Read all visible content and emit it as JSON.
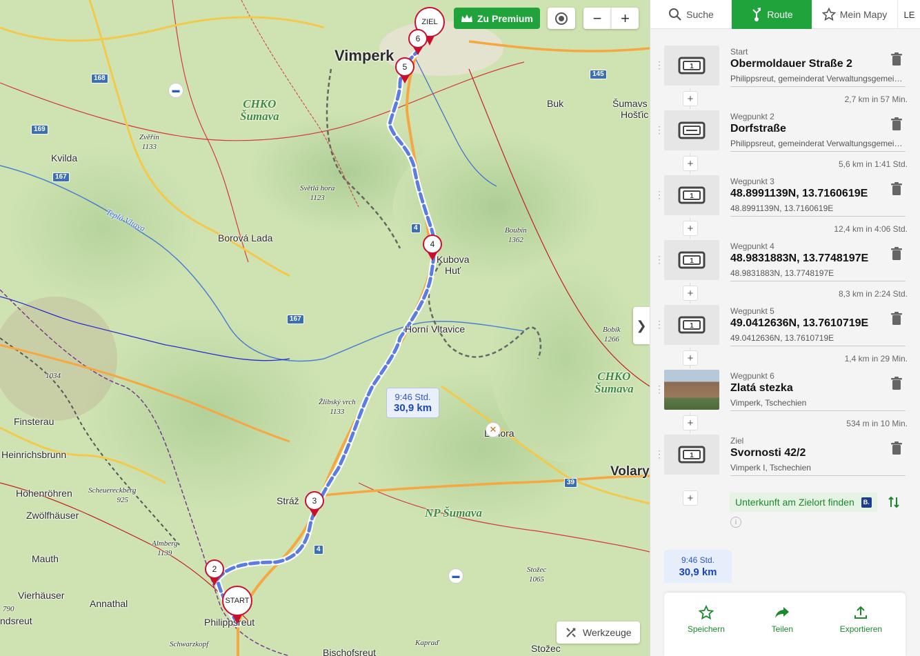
{
  "map": {
    "labels": {
      "vimperk": "Vimperk",
      "chko1": "CHKO",
      "chko1b": "Šumava",
      "buk": "Buk",
      "sumavske": "Šumavs",
      "hostice": "Hošťic",
      "zverin": "Zvěřín",
      "zverin_ele": "1133",
      "kvilda": "Kvilda",
      "svetla_hora": "Světlá hora",
      "svetla_hora_ele": "1123",
      "tepla_vltava": "Teplá Vltava",
      "borova_lada": "Borová Lada",
      "boubin": "Boubín",
      "boubin_ele": "1362",
      "kubova": "Kubova",
      "hut": "Huť",
      "horni_vltavice": "Horní Vltavice",
      "bobik": "Bobík",
      "bobik_ele": "1266",
      "chko2": "CHKO",
      "chko2b": "Šumava",
      "ele_1034": "1034",
      "finsterau": "Finsterau",
      "heinrichsbrunn": "Heinrichsbrunn",
      "zlibsky": "Žlibský vrch",
      "zlibsky_ele": "1133",
      "lenora": "Lenora",
      "hohenrohren": "Hohenröhren",
      "scheuereckberg": "Scheuereckberg",
      "ele_925": "925",
      "zwolfhauser": "Zwölfhäuser",
      "straz": "Stráž",
      "np_sumava": "NP Šumava",
      "volary": "Volary",
      "almberg": "Almberg",
      "almberg_ele": "1139",
      "mauth": "Mauth",
      "vierhauser": "Vierhäuser",
      "annathal": "Annathal",
      "ele_790": "790",
      "ndsreut": "ndsreut",
      "philippsreut": "Philippsreut",
      "schwarzkopf": "Schwarzkopf",
      "kaprad": "Kapraď",
      "bischofsreut": "Bischofsreut",
      "stozec": "Stožec",
      "stozec_ele": "1065",
      "stozec2": "Stožec"
    },
    "road_shields": [
      "168",
      "169",
      "167",
      "145",
      "4",
      "167",
      "39",
      "4"
    ],
    "markers": {
      "ziel": "ZIEL",
      "m6": "6",
      "m5": "5",
      "m4": "4",
      "m3": "3",
      "m2": "2",
      "start": "START"
    },
    "route_bubble": {
      "time": "9:46 Std.",
      "distance": "30,9 km"
    },
    "controls": {
      "premium": "Zu Premium",
      "zoom_out": "−",
      "zoom_in": "+",
      "tools": "Werkzeuge"
    }
  },
  "tabs": {
    "search": "Suche",
    "route": "Route",
    "my_map": "Mein Mapy",
    "avatar": "LE"
  },
  "waypoints": [
    {
      "label": "Start",
      "name": "Obermoldauer Straße 2",
      "sub": "Philippsreut, gemeinderat Verwaltungsgemei…",
      "thumb": "1"
    },
    {
      "label": "Wegpunkt 2",
      "name": "Dorfstraße",
      "sub": "Philippsreut, gemeinderat Verwaltungsgemei…",
      "thumb": ""
    },
    {
      "label": "Wegpunkt 3",
      "name": "48.8991139N, 13.7160619E",
      "sub": "48.8991139N, 13.7160619E",
      "thumb": "1"
    },
    {
      "label": "Wegpunkt 4",
      "name": "48.9831883N, 13.7748197E",
      "sub": "48.9831883N, 13.7748197E",
      "thumb": "1"
    },
    {
      "label": "Wegpunkt 5",
      "name": "49.0412636N, 13.7610719E",
      "sub": "49.0412636N, 13.7610719E",
      "thumb": "1"
    },
    {
      "label": "Wegpunkt 6",
      "name": "Zlatá stezka",
      "sub": "Vimperk, Tschechien",
      "thumb": "photo"
    },
    {
      "label": "Ziel",
      "name": "Svornosti 42/2",
      "sub": "Vimperk I, Tschechien",
      "thumb": "1"
    }
  ],
  "segments": [
    "2,7 km in 57 Min.",
    "5,6 km in 1:41 Std.",
    "12,4 km in 4:06 Std.",
    "8,3 km in 2:24 Std.",
    "1,4 km in 29 Min.",
    "534 m in 10 Min."
  ],
  "accommodation": {
    "label": "Unterkunft am Zielort finden",
    "badge": "B."
  },
  "info": "i",
  "summary": {
    "time": "9:46 Std.",
    "distance": "30,9 km"
  },
  "actions": {
    "save": "Speichern",
    "share": "Teilen",
    "export": "Exportieren"
  },
  "colors": {
    "accent": "#1fa33a",
    "route": "#5b7de0",
    "marker": "#c8102e"
  }
}
